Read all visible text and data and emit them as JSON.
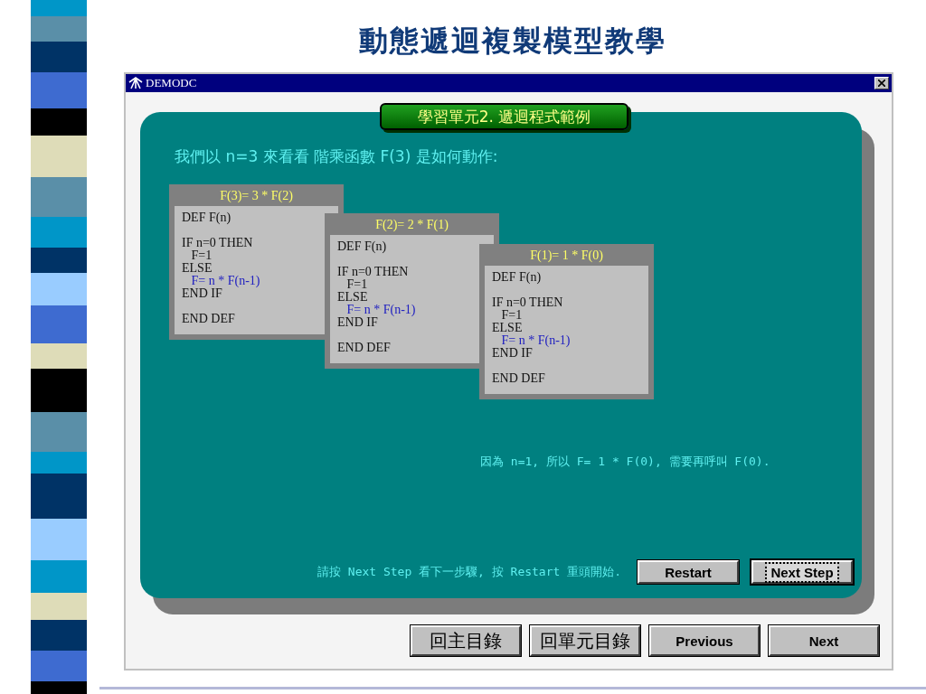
{
  "slide_title": "動態遞迴複製模型教學",
  "window": {
    "title": "DEMODC"
  },
  "lesson_label": "學習單元2. 遞迴程式範例",
  "intro": "我們以 n=3 來看看 階乘函數 F(3) 是如何動作:",
  "code_cards": [
    {
      "header": "F(3)= 3 * F(2)",
      "blocks": [
        [
          {
            "text": "DEF F(n)",
            "kind": "plain"
          }
        ],
        [
          {
            "text": "IF n=0 THEN",
            "kind": "plain"
          },
          {
            "text": "   F=1",
            "kind": "plain"
          },
          {
            "text": "ELSE",
            "kind": "plain"
          },
          {
            "text": "   F= n * F(n-1)",
            "kind": "call"
          },
          {
            "text": "END IF",
            "kind": "plain"
          }
        ],
        [
          {
            "text": "END DEF",
            "kind": "plain"
          }
        ]
      ]
    },
    {
      "header": "F(2)= 2 * F(1)",
      "blocks": [
        [
          {
            "text": "DEF F(n)",
            "kind": "plain"
          }
        ],
        [
          {
            "text": "IF n=0 THEN",
            "kind": "plain"
          },
          {
            "text": "   F=1",
            "kind": "plain"
          },
          {
            "text": "ELSE",
            "kind": "plain"
          },
          {
            "text": "   F= n * F(n-1)",
            "kind": "call"
          },
          {
            "text": "END IF",
            "kind": "plain"
          }
        ],
        [
          {
            "text": "END DEF",
            "kind": "plain"
          }
        ]
      ]
    },
    {
      "header": "F(1)= 1 * F(0)",
      "blocks": [
        [
          {
            "text": "DEF F(n)",
            "kind": "plain"
          }
        ],
        [
          {
            "text": "IF n=0 THEN",
            "kind": "plain"
          },
          {
            "text": "   F=1",
            "kind": "plain"
          },
          {
            "text": "ELSE",
            "kind": "plain"
          },
          {
            "text": "   F= n * F(n-1)",
            "kind": "call"
          },
          {
            "text": "END IF",
            "kind": "plain"
          }
        ],
        [
          {
            "text": "END DEF",
            "kind": "plain"
          }
        ]
      ]
    }
  ],
  "explanation": "因為 n=1, 所以 F= 1 * F(0), 需要再呼叫 F(0).",
  "hint": "請按 Next Step 看下一步驟, 按 Restart 重頭開始.",
  "step_buttons": [
    {
      "label": "Restart",
      "focused": false
    },
    {
      "label": "Next Step",
      "focused": true
    }
  ],
  "nav_buttons": [
    {
      "label": "回主目錄",
      "kind": "cjk"
    },
    {
      "label": "回單元目錄",
      "kind": "cjk"
    },
    {
      "label": "Previous",
      "kind": "latin"
    },
    {
      "label": "Next",
      "kind": "latin"
    }
  ]
}
